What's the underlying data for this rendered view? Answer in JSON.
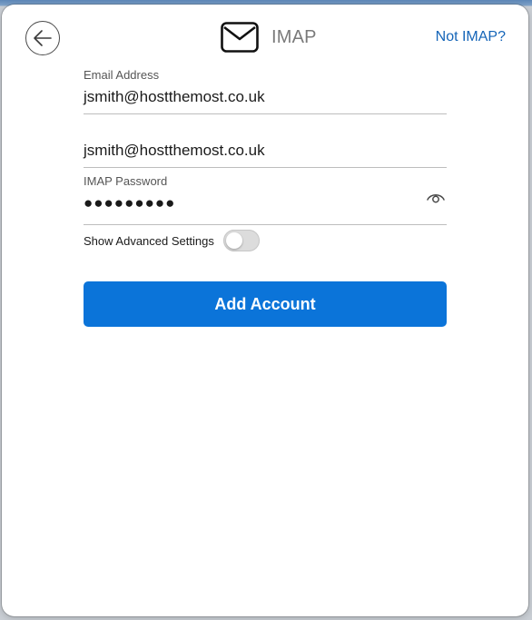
{
  "header": {
    "title": "IMAP",
    "not_imap_link": "Not IMAP?"
  },
  "form": {
    "email_address": {
      "label": "Email Address",
      "value": "jsmith@hostthemost.co.uk"
    },
    "username": {
      "value": "jsmith@hostthemost.co.uk"
    },
    "imap_password": {
      "label": "IMAP Password",
      "masked_value": "●●●●●●●●●"
    },
    "advanced_settings": {
      "label": "Show Advanced Settings",
      "enabled": false
    },
    "submit_label": "Add Account"
  },
  "colors": {
    "accent": "#0b74d9",
    "link": "#1565b8",
    "toggle_off": "#dcdcdc"
  },
  "icons": {
    "back": "back-arrow-icon",
    "mail": "envelope-icon",
    "reveal_password": "eye-icon"
  }
}
